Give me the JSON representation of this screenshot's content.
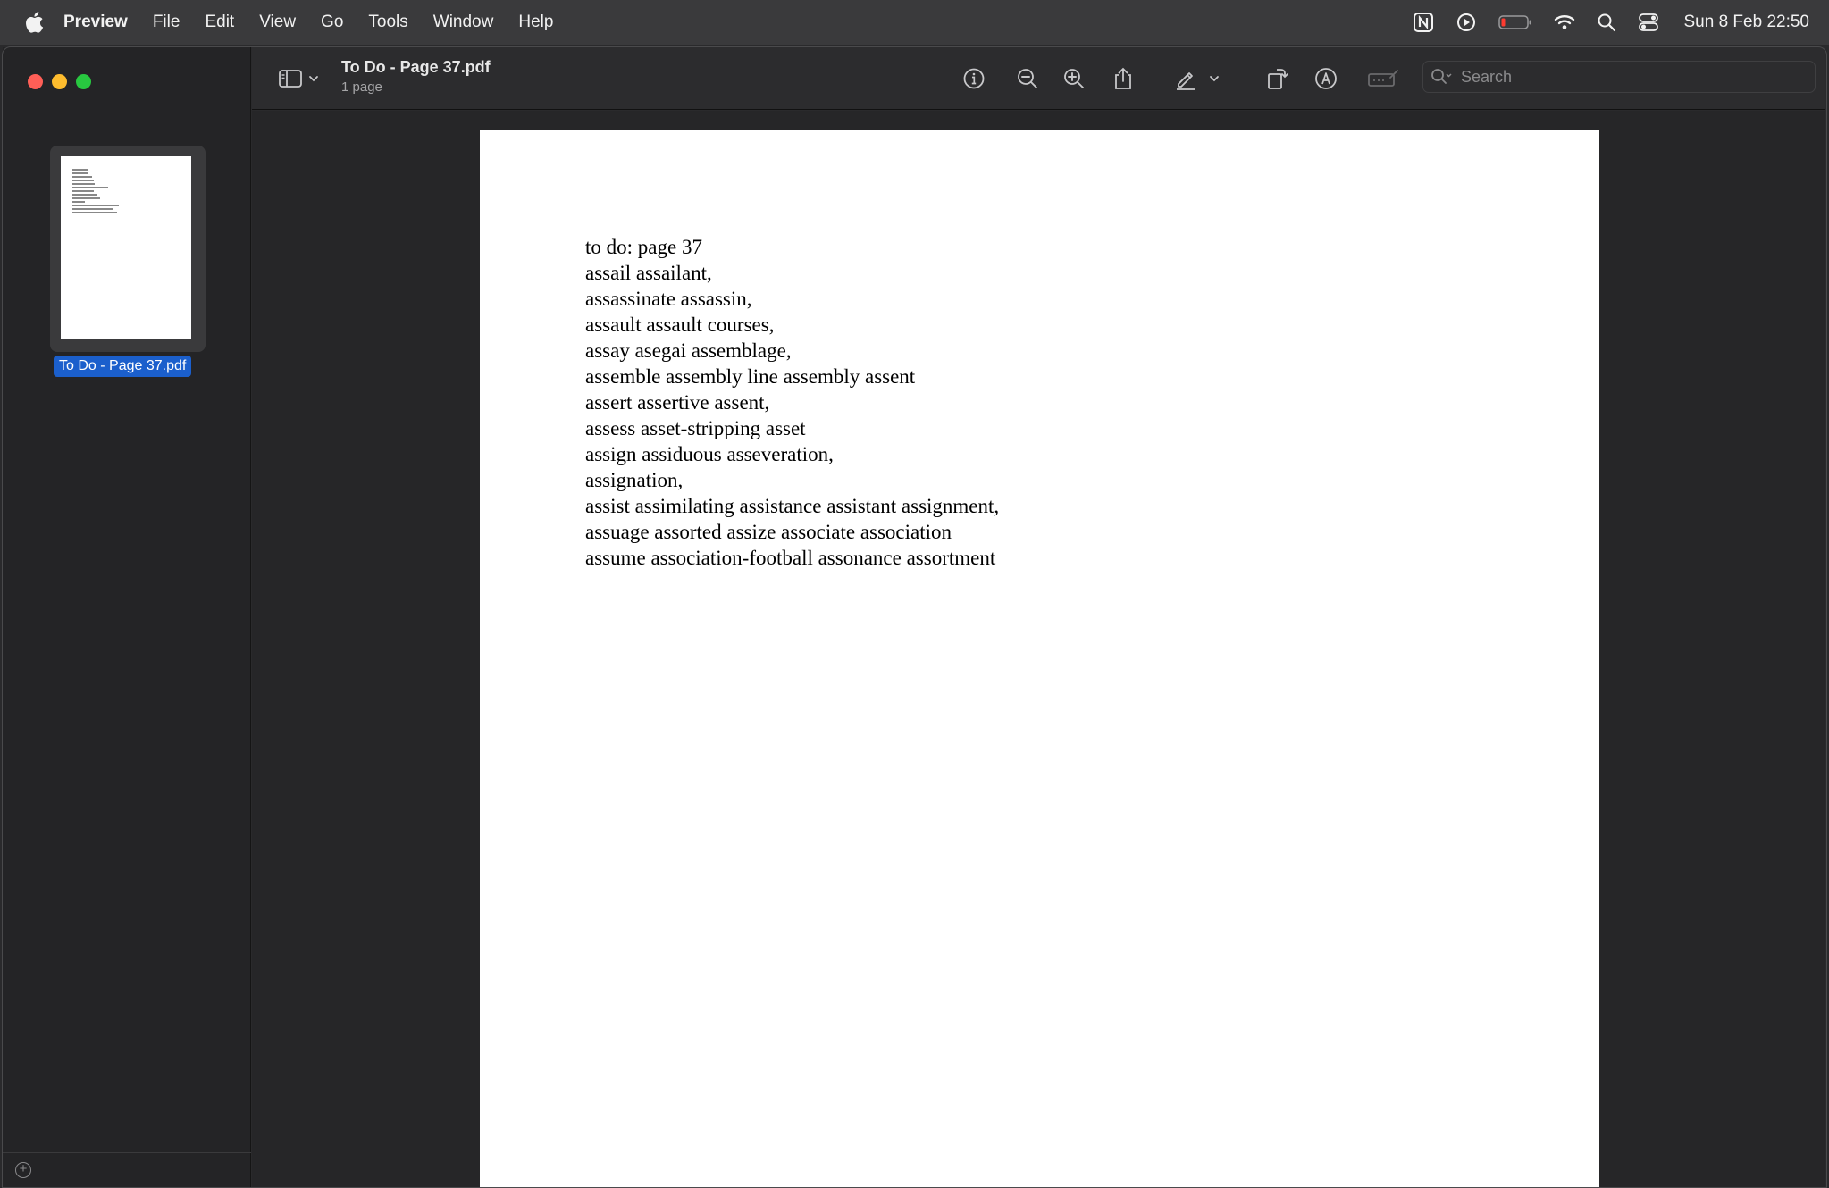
{
  "menubar": {
    "app_name": "Preview",
    "items": [
      "File",
      "Edit",
      "View",
      "Go",
      "Tools",
      "Window",
      "Help"
    ],
    "clock": "Sun 8 Feb  22:50",
    "icons": [
      "notion-icon",
      "play-circle-icon",
      "battery-icon",
      "wifi-icon",
      "spotlight-search-icon",
      "control-center-icon"
    ]
  },
  "window": {
    "title": "To Do - Page 37.pdf",
    "subtitle": "1 page"
  },
  "sidebar": {
    "thumbnail_label": "To Do - Page 37.pdf"
  },
  "toolbar": {
    "search_placeholder": "Search"
  },
  "document": {
    "lines": [
      "to do: page 37",
      "assail assailant,",
      "assassinate assassin,",
      "assault assault courses,",
      "assay asegai assemblage,",
      "assemble assembly line assembly assent",
      "assert assertive assent,",
      "assess asset-stripping asset",
      "assign assiduous asseveration,",
      "assignation,",
      "assist assimilating assistance assistant assignment,",
      "assuage assorted assize associate association",
      "assume association-football assonance assortment"
    ]
  },
  "colors": {
    "menubar_bg": "#3a3a3c",
    "selection": "#1b5fcc",
    "close": "#ff5f57",
    "minimize": "#febc2e",
    "zoom": "#28c840"
  }
}
